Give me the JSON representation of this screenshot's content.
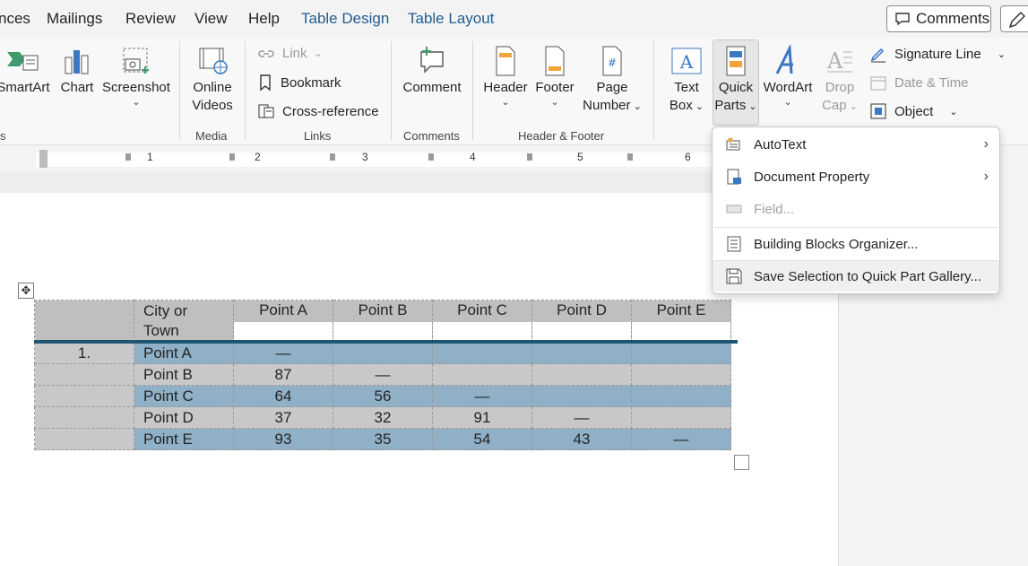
{
  "tabs": {
    "items": [
      "nces",
      "Mailings",
      "Review",
      "View",
      "Help",
      "Table Design",
      "Table Layout"
    ],
    "comments_label": "Comments"
  },
  "ribbon": {
    "smartart": "SmartArt",
    "chart": "Chart",
    "screenshot": "Screenshot",
    "online_videos_1": "Online",
    "online_videos_2": "Videos",
    "media_group": "Media",
    "link": "Link",
    "bookmark": "Bookmark",
    "cross_reference": "Cross-reference",
    "links_group": "Links",
    "comment": "Comment",
    "comments_group": "Comments",
    "header": "Header",
    "footer": "Footer",
    "page_number_1": "Page",
    "page_number_2": "Number",
    "header_footer_group": "Header & Footer",
    "text_box_1": "Text",
    "text_box_2": "Box",
    "quick_parts_1": "Quick",
    "quick_parts_2": "Parts",
    "wordart": "WordArt",
    "drop_cap_1": "Drop",
    "drop_cap_2": "Cap",
    "signature_line": "Signature Line",
    "date_time": "Date & Time",
    "object": "Object",
    "left_group_fragment": "s"
  },
  "ruler": {
    "numbers": [
      "1",
      "2",
      "3",
      "4",
      "5",
      "6"
    ]
  },
  "table": {
    "header": [
      "",
      "City or Town",
      "Point A",
      "Point B",
      "Point C",
      "Point D",
      "Point E"
    ],
    "header_line1": "City or",
    "header_line2": "Town",
    "rows": [
      [
        "1.",
        "Point A",
        "—",
        "",
        "",
        "",
        ""
      ],
      [
        "",
        "Point B",
        "87",
        "—",
        "",
        "",
        ""
      ],
      [
        "",
        "Point C",
        "64",
        "56",
        "—",
        "",
        ""
      ],
      [
        "",
        "Point D",
        "37",
        "32",
        "91",
        "—",
        ""
      ],
      [
        "",
        "Point E",
        "93",
        "35",
        "54",
        "43",
        "—"
      ]
    ]
  },
  "menu": {
    "autotext": "AutoText",
    "document_property": "Document Property",
    "field": "Field...",
    "building_blocks": "Building Blocks Organizer...",
    "save_selection": "Save Selection to Quick Part Gallery..."
  },
  "colors": {
    "context_tab": "#1f5e93",
    "selection": "#8fb0c6",
    "table_rule": "#1e5572"
  }
}
